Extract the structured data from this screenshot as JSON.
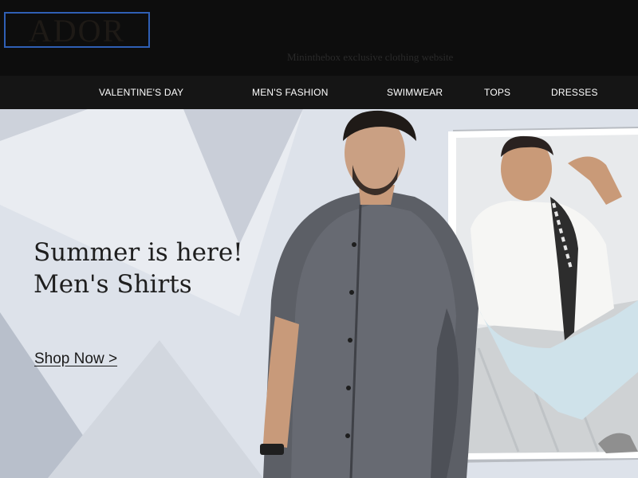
{
  "brand": {
    "logo_text": "ADOR",
    "tagline": "Mininthebox exclusive clothing website"
  },
  "nav": {
    "items": [
      {
        "label": "VALENTINE'S DAY"
      },
      {
        "label": "MEN'S FASHION"
      },
      {
        "label": "SWIMWEAR"
      },
      {
        "label": "TOPS"
      },
      {
        "label": "DRESSES"
      }
    ]
  },
  "hero": {
    "headline_line1": "Summer is here!",
    "headline_line2": "Men's Shirts",
    "cta_label": "Shop Now >"
  },
  "colors": {
    "page_bg": "#0d0d0d",
    "nav_bg": "#151515",
    "logo_border": "#2f5fb5",
    "hero_bg": "#dde2ea"
  }
}
